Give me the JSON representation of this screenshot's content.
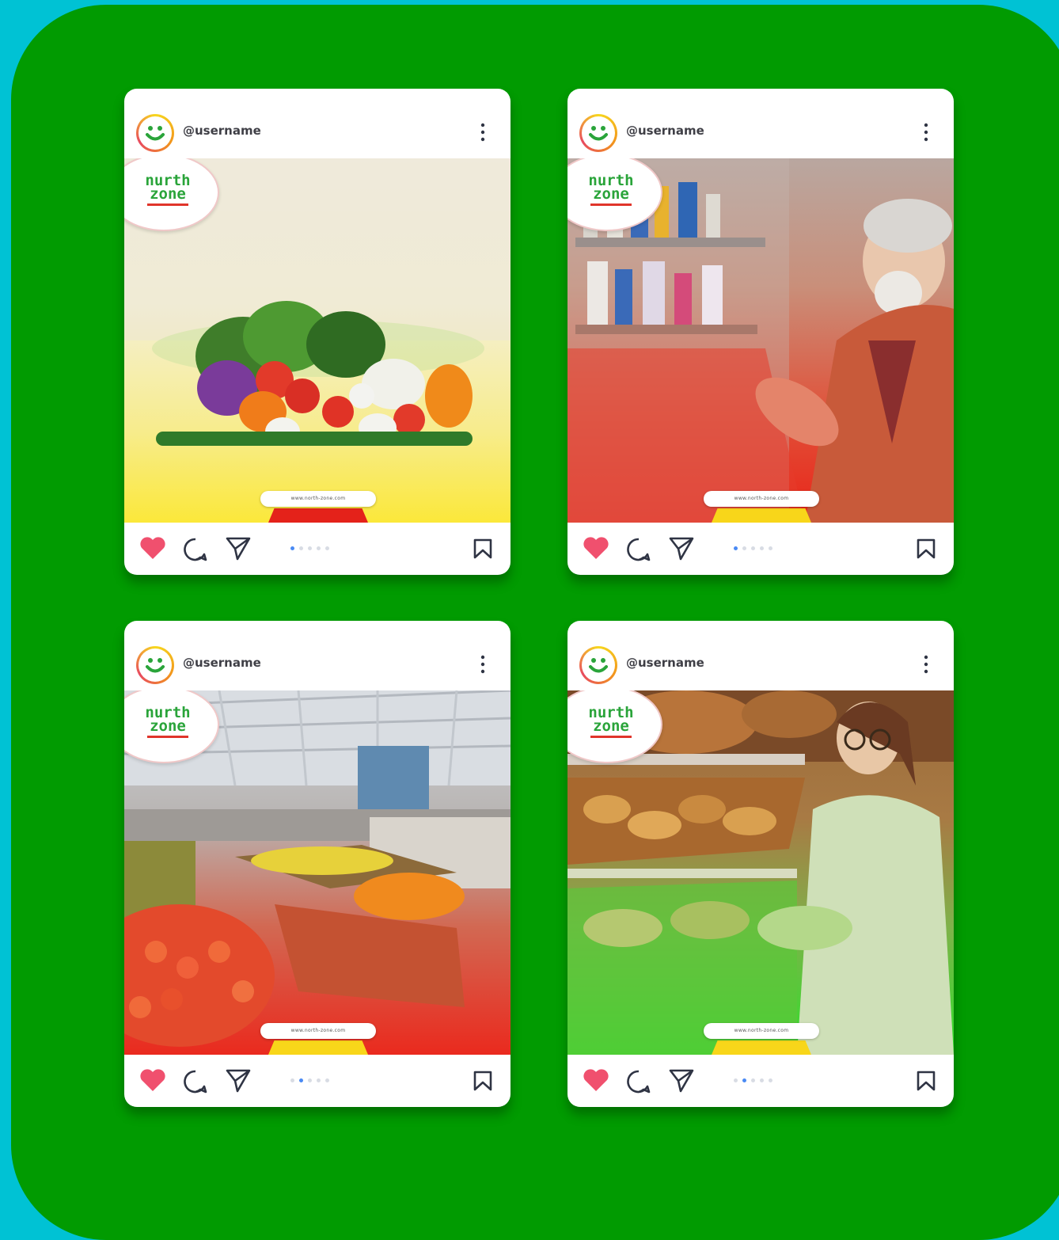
{
  "posts": [
    {
      "username": "@username",
      "logo": {
        "line1": "nurth",
        "line2": "zone"
      },
      "url": "www.north-zone.com",
      "active_dot": 0,
      "dot_count": 5,
      "theme": "yellow",
      "scene": "vegetables"
    },
    {
      "username": "@username",
      "logo": {
        "line1": "nurth",
        "line2": "zone"
      },
      "url": "www.north-zone.com",
      "active_dot": 0,
      "dot_count": 5,
      "theme": "red",
      "scene": "shopper-aisle"
    },
    {
      "username": "@username",
      "logo": {
        "line1": "nurth",
        "line2": "zone"
      },
      "url": "www.north-zone.com",
      "active_dot": 1,
      "dot_count": 5,
      "theme": "red",
      "scene": "produce-section"
    },
    {
      "username": "@username",
      "logo": {
        "line1": "nurth",
        "line2": "zone"
      },
      "url": "www.north-zone.com",
      "active_dot": 1,
      "dot_count": 5,
      "theme": "green",
      "scene": "bakery-shopper"
    }
  ],
  "colors": {
    "background": "#00c2d4",
    "panel": "#019b01",
    "heart": "#f0506e",
    "icon_stroke": "#2f3444",
    "dot_active": "#4a8af4"
  },
  "icons": {
    "heart": "heart-icon",
    "comment": "comment-icon",
    "share": "send-icon",
    "save": "bookmark-icon",
    "more": "more-vertical-icon",
    "avatar": "smiley-avatar"
  }
}
